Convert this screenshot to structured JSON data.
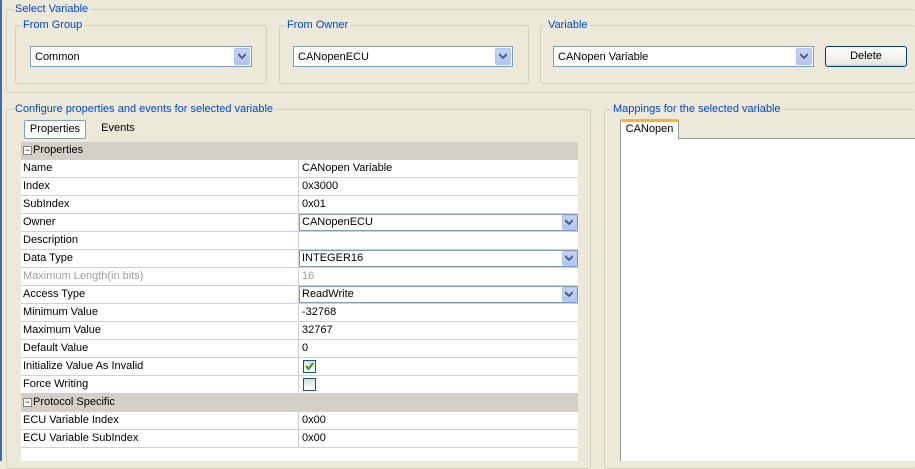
{
  "select_variable": {
    "legend": "Select Variable",
    "from_group": {
      "legend": "From Group",
      "value": "Common"
    },
    "from_owner": {
      "legend": "From Owner",
      "value": "CANopenECU"
    },
    "variable": {
      "legend": "Variable",
      "value": "CANopen Variable"
    },
    "delete_label": "Delete"
  },
  "configure": {
    "legend": "Configure properties and events for selected variable",
    "tabs": [
      "Properties",
      "Events"
    ],
    "categories": {
      "properties": "Properties",
      "protocol": "Protocol Specific"
    },
    "rows": [
      {
        "name": "Name",
        "value": "CANopen Variable"
      },
      {
        "name": "Index",
        "value": "0x3000"
      },
      {
        "name": "SubIndex",
        "value": "0x01"
      },
      {
        "name": "Owner",
        "value": "CANopenECU"
      },
      {
        "name": "Description",
        "value": ""
      },
      {
        "name": "Data Type",
        "value": "INTEGER16"
      },
      {
        "name": "Maximum Length(in bits)",
        "value": "16"
      },
      {
        "name": "Access Type",
        "value": "ReadWrite"
      },
      {
        "name": "Minimum Value",
        "value": "-32768"
      },
      {
        "name": "Maximum Value",
        "value": "32767"
      },
      {
        "name": "Default Value",
        "value": "0"
      },
      {
        "name": "Initialize Value As Invalid",
        "checked": true
      },
      {
        "name": "Force Writing",
        "checked": false
      }
    ],
    "protocol_rows": [
      {
        "name": "ECU Variable Index",
        "value": "0x00"
      },
      {
        "name": "ECU Variable SubIndex",
        "value": "0x00"
      }
    ]
  },
  "mappings": {
    "legend": "Mappings for the selected variable",
    "tab": "CANopen"
  },
  "colors": {
    "legend_blue": "#0046d5",
    "tab_orange": "#f7b342",
    "border_blue": "#7f9db9"
  }
}
